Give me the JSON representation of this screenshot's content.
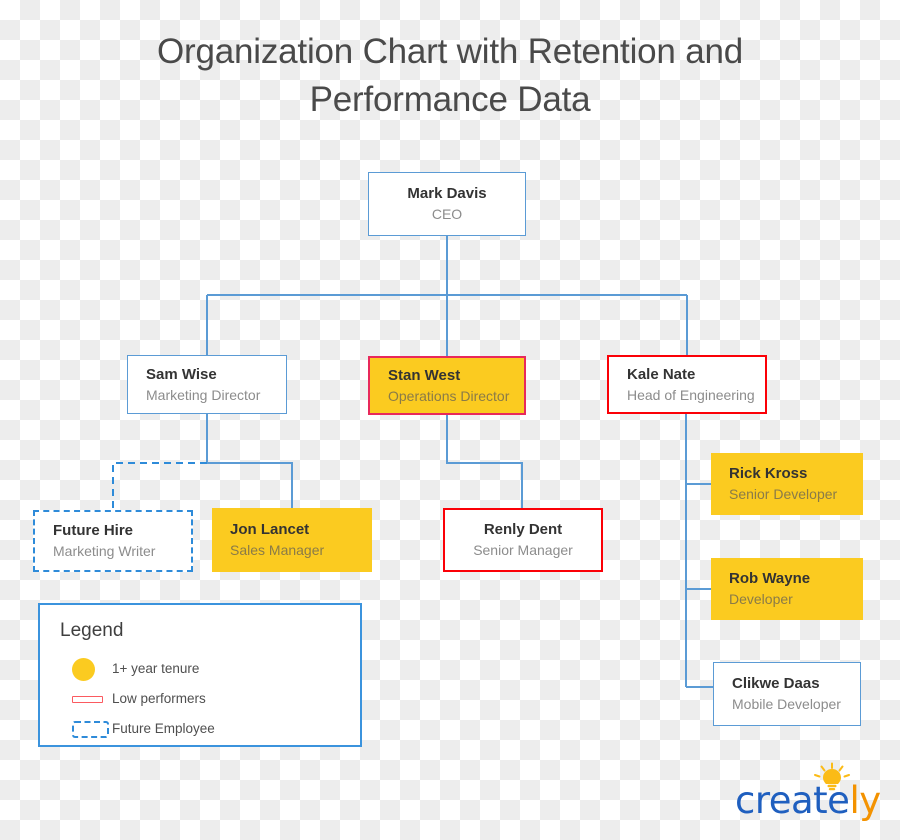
{
  "title": "Organization Chart with Retention and Performance Data",
  "colors": {
    "blue_border": "#5b9bd5",
    "red_border": "#fb0007",
    "crimson_border": "#e8295b",
    "dashed_blue": "#2e8bd9",
    "yellow_fill": "#fbcb20",
    "connector": "#5b9bd5",
    "title_text": "#4a4a4a",
    "name_text": "#333333",
    "role_text": "#8c8c8c",
    "legend_border": "#3b93dd"
  },
  "nodes": [
    {
      "id": "ceo",
      "name": "Mark Davis",
      "role": "CEO",
      "style": "blue-border",
      "align": "center"
    },
    {
      "id": "marketing",
      "name": "Sam Wise",
      "role": "Marketing Director",
      "style": "blue-border",
      "align": "left"
    },
    {
      "id": "operations",
      "name": "Stan West",
      "role": "Operations Director",
      "style": "yellow-crimson",
      "align": "left"
    },
    {
      "id": "engineering",
      "name": "Kale Nate",
      "role": "Head of Engineering",
      "style": "red-border",
      "align": "left"
    },
    {
      "id": "futurehire",
      "name": "Future Hire",
      "role": "Marketing Writer",
      "style": "dashed-blue",
      "align": "left"
    },
    {
      "id": "sales",
      "name": "Jon Lancet",
      "role": "Sales Manager",
      "style": "yellow-fill",
      "align": "left"
    },
    {
      "id": "senior",
      "name": "Renly Dent",
      "role": "Senior Manager",
      "style": "red-border",
      "align": "center"
    },
    {
      "id": "rick",
      "name": "Rick Kross",
      "role": "Senior Developer",
      "style": "yellow-fill",
      "align": "left"
    },
    {
      "id": "rob",
      "name": "Rob Wayne",
      "role": "Developer",
      "style": "yellow-fill",
      "align": "left"
    },
    {
      "id": "clikwe",
      "name": "Clikwe Daas",
      "role": "Mobile Developer",
      "style": "blue-border",
      "align": "left"
    }
  ],
  "legend": {
    "title": "Legend",
    "items": [
      {
        "swatch": "yellow-circle",
        "label": "1+ year tenure"
      },
      {
        "swatch": "red-outline-bar",
        "label": "Low performers"
      },
      {
        "swatch": "blue-dashed-rect",
        "label": "Future Employee"
      }
    ]
  },
  "logo": {
    "part1": "create",
    "part2": "ly",
    "icon": "lightbulb-icon"
  }
}
